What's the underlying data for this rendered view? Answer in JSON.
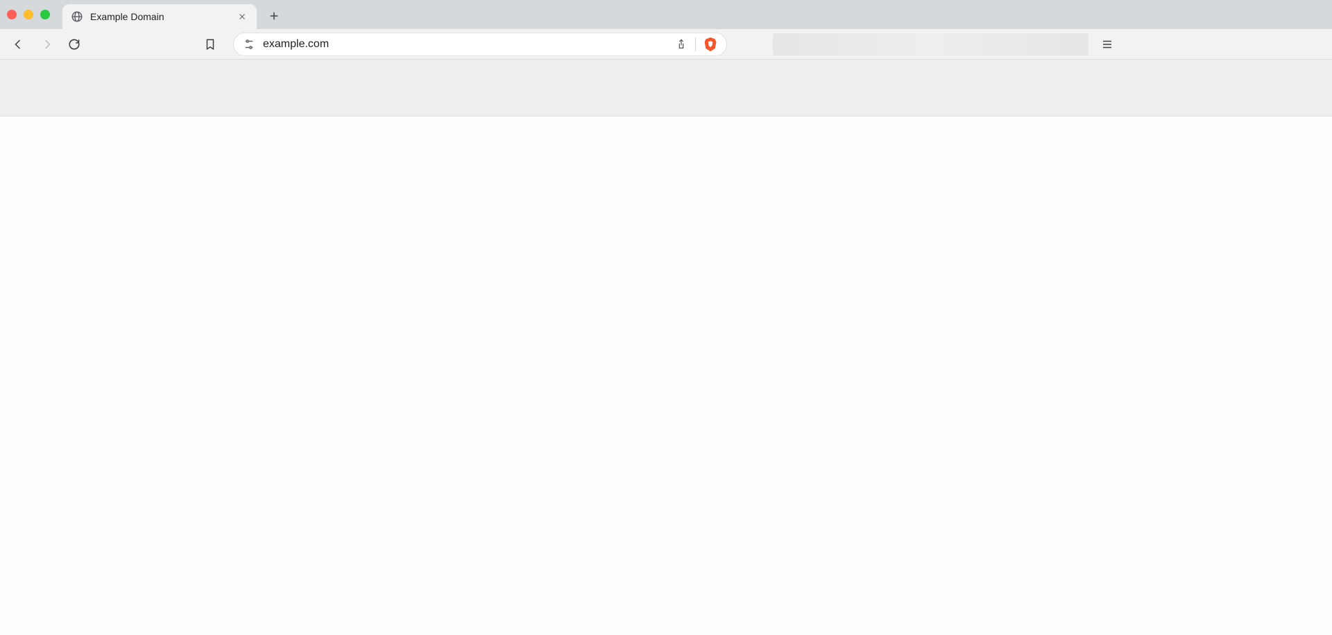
{
  "tab": {
    "title": "Example Domain"
  },
  "address": {
    "url": "example.com"
  }
}
